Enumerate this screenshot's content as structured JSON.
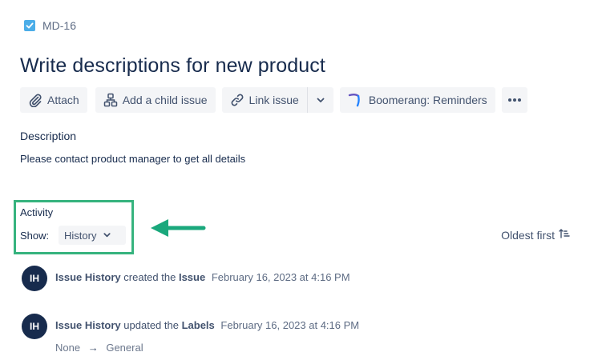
{
  "issue": {
    "key": "MD-16",
    "title": "Write descriptions for new product"
  },
  "toolbar": {
    "attach_label": "Attach",
    "add_child_label": "Add a child issue",
    "link_issue_label": "Link issue",
    "boomerang_label": "Boomerang: Reminders"
  },
  "description": {
    "label": "Description",
    "text": "Please contact product manager to get all details"
  },
  "activity": {
    "label": "Activity",
    "show_label": "Show:",
    "show_value": "History",
    "sort_label": "Oldest first"
  },
  "history": [
    {
      "initials": "IH",
      "actor": "Issue History",
      "verb": "created the",
      "object": "Issue",
      "timestamp": "February 16, 2023 at 4:16 PM"
    },
    {
      "initials": "IH",
      "actor": "Issue History",
      "verb": "updated the",
      "object": "Labels",
      "timestamp": "February 16, 2023 at 4:16 PM",
      "from": "None",
      "arrow": "→",
      "to": "General"
    }
  ],
  "colors": {
    "highlight": "#36b37e",
    "annotation_arrow": "#1aa87c",
    "avatar": "#172b4d",
    "checkbox": "#4bade8"
  },
  "icons": [
    "checkbox-icon",
    "paperclip-icon",
    "hierarchy-icon",
    "link-icon",
    "chevron-down-icon",
    "boomerang-icon",
    "more-icon",
    "sort-ascending-icon",
    "annotation-arrow"
  ]
}
